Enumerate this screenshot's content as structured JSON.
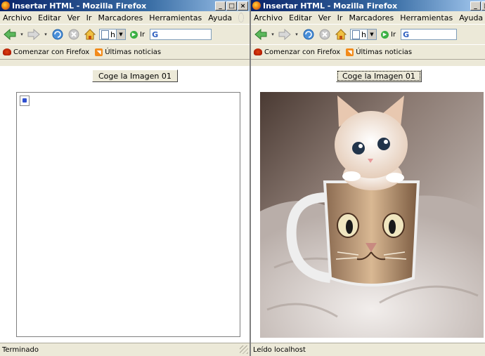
{
  "windows": [
    {
      "title": "Insertar HTML - Mozilla Firefox",
      "menu": [
        "Archivo",
        "Editar",
        "Ver",
        "Ir",
        "Marcadores",
        "Herramientas",
        "Ayuda"
      ],
      "url_text": "h",
      "go_label": "Ir",
      "bookmarks": [
        "Comenzar con Firefox",
        "Últimas noticias"
      ],
      "button_label": "Coge la Imagen 01",
      "status": "Terminado"
    },
    {
      "title": "Insertar HTML - Mozilla Firefox",
      "menu": [
        "Archivo",
        "Editar",
        "Ver",
        "Ir",
        "Marcadores",
        "Herramientas",
        "Ayuda"
      ],
      "url_text": "h",
      "go_label": "Ir",
      "bookmarks": [
        "Comenzar con Firefox",
        "Últimas noticias"
      ],
      "button_label": "Coge la Imagen 01",
      "status": "Leído localhost"
    }
  ],
  "window_controls": [
    "_",
    "□",
    "×"
  ],
  "search_glyph": "G",
  "colors": {
    "titlebar": "#0a246a",
    "chrome": "#ece9d8",
    "content": "#ffffff"
  },
  "icons": [
    "back-arrow-icon",
    "forward-arrow-icon",
    "reload-icon",
    "stop-icon",
    "home-icon",
    "go-icon",
    "firefox-icon",
    "rss-icon",
    "broken-image-icon"
  ]
}
